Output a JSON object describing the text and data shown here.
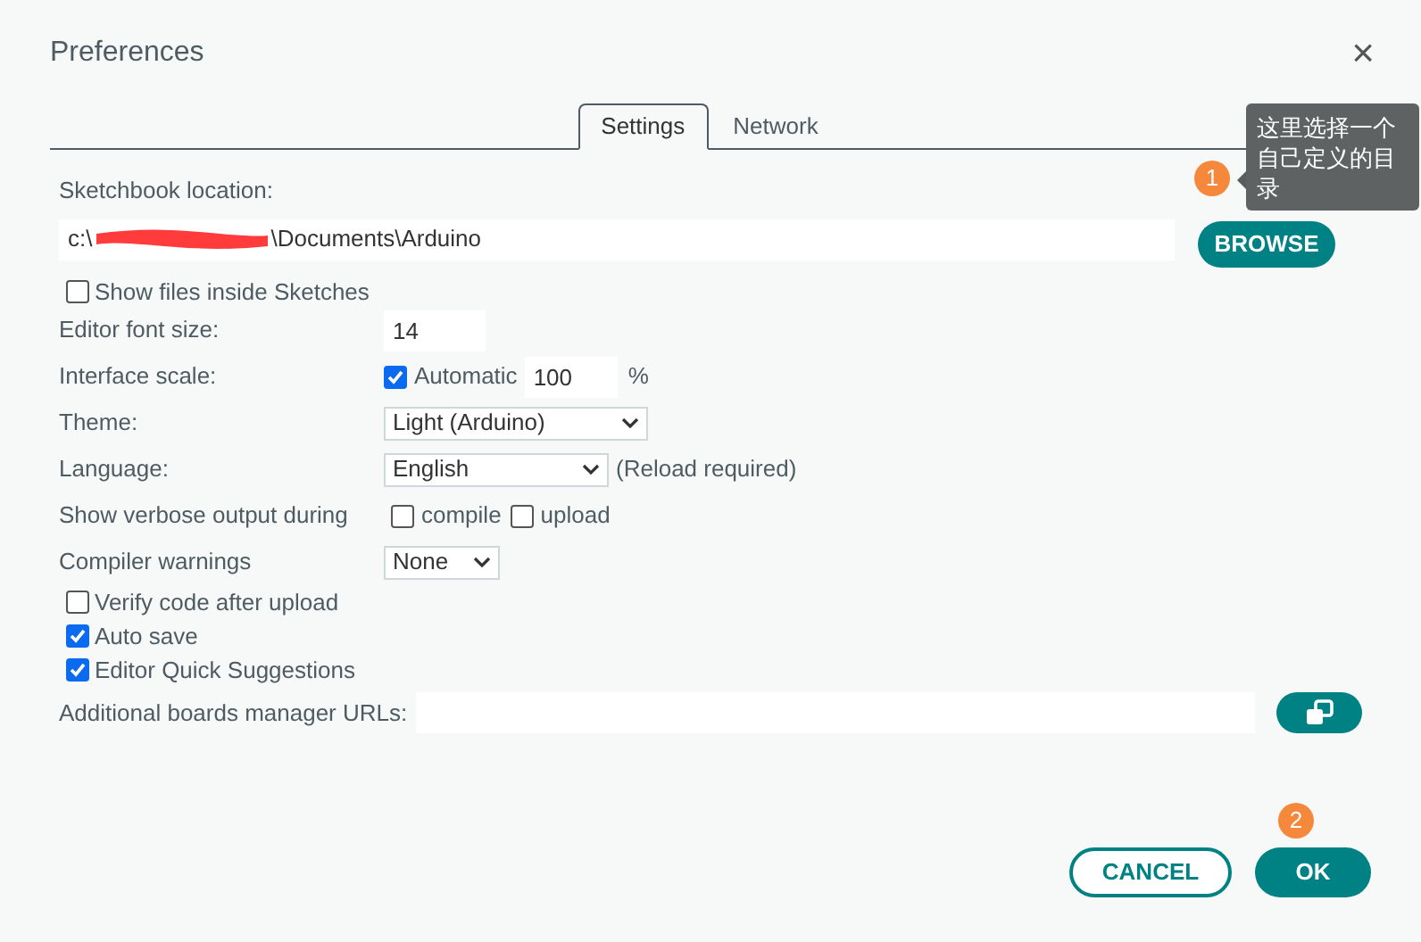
{
  "window": {
    "title": "Preferences",
    "close": "×"
  },
  "tabs": [
    {
      "label": "Settings",
      "selected": true
    },
    {
      "label": "Network",
      "selected": false
    }
  ],
  "sketchbook": {
    "label": "Sketchbook location:",
    "path_start": "c:\\",
    "path_end": "\\Documents\\Arduino",
    "browse": "BROWSE"
  },
  "show_files": {
    "label": "Show files inside Sketches",
    "checked": false
  },
  "settings": [
    {
      "kind": "input",
      "label": "Editor font size:",
      "value": "14"
    },
    {
      "kind": "scale",
      "label": "Interface scale:",
      "checkbox_label": "Automatic",
      "checked": true,
      "value": "100",
      "unit": "%"
    },
    {
      "kind": "select",
      "label": "Theme:",
      "value": "Light (Arduino)"
    },
    {
      "kind": "select",
      "label": "Language:",
      "value": "English",
      "note": "(Reload required)"
    },
    {
      "kind": "checks",
      "label": "Show verbose output during",
      "options": [
        {
          "label": "compile",
          "checked": false
        },
        {
          "label": "upload",
          "checked": false
        }
      ]
    },
    {
      "kind": "select",
      "label": "Compiler warnings",
      "value": "None"
    }
  ],
  "options": [
    {
      "label": "Verify code after upload",
      "checked": false
    },
    {
      "label": "Auto save",
      "checked": true
    },
    {
      "label": "Editor Quick Suggestions",
      "checked": true
    }
  ],
  "boards_urls": {
    "label": "Additional boards manager URLs:"
  },
  "buttons": [
    {
      "label": "CANCEL",
      "kind": "outline"
    },
    {
      "label": "OK",
      "kind": "primary"
    }
  ],
  "annotations": [
    {
      "number": "1"
    },
    {
      "number": "2"
    }
  ],
  "tooltip": "这里选择一个自己定义的目录"
}
